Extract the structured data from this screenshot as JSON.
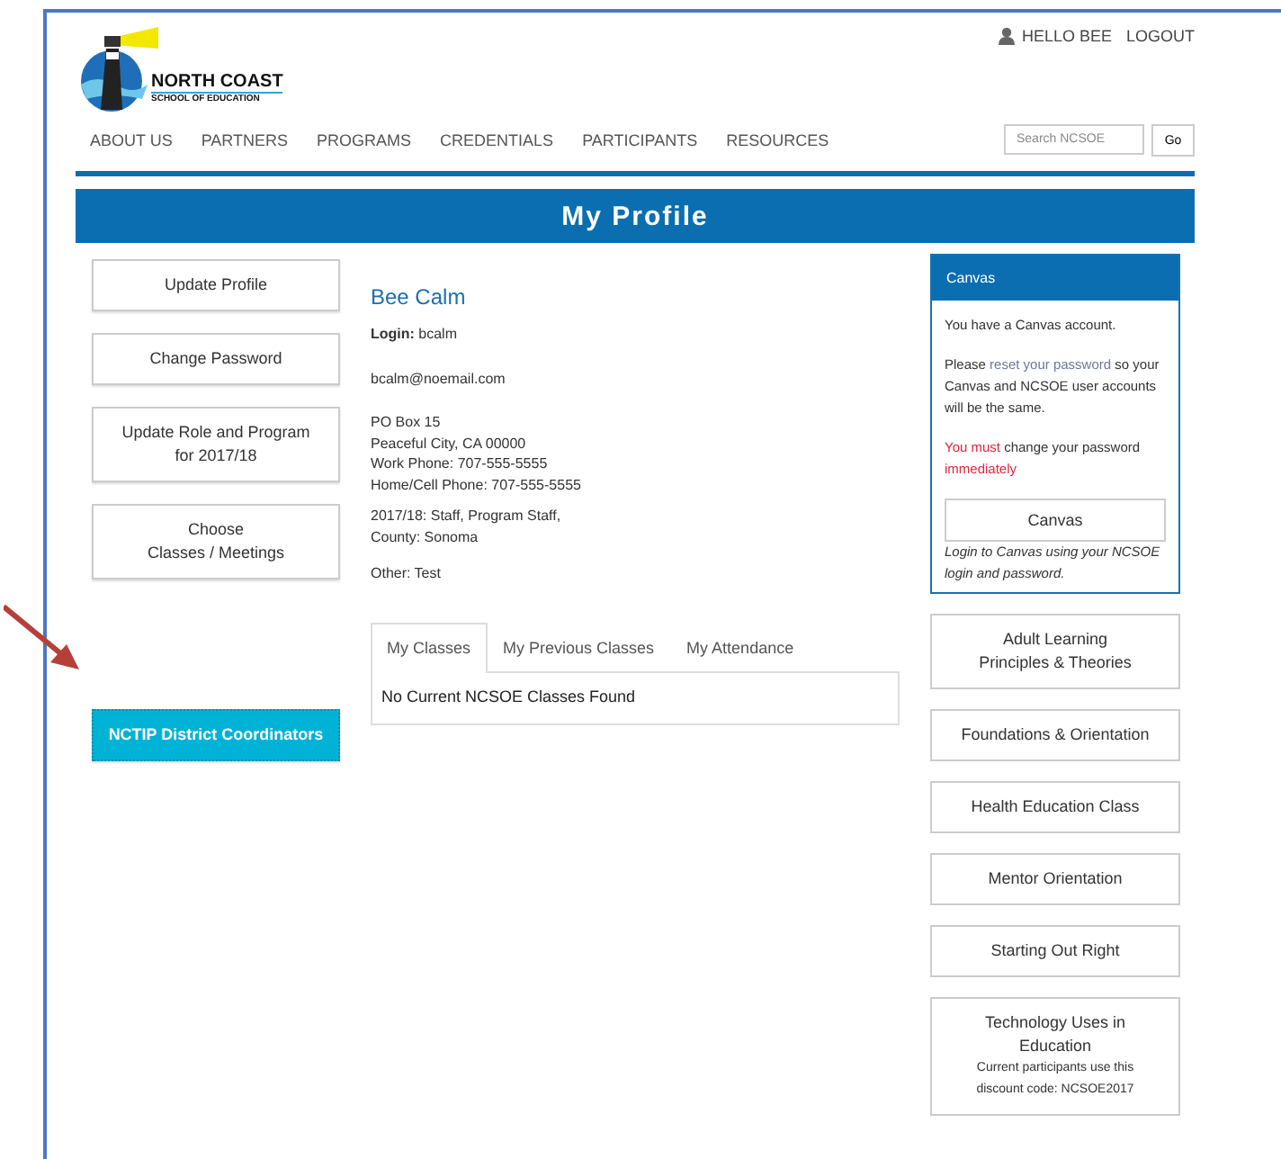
{
  "user_bar": {
    "greeting": "HELLO BEE",
    "logout": "LOGOUT"
  },
  "logo": {
    "name": "NORTH COAST",
    "subtitle": "SCHOOL OF EDUCATION"
  },
  "nav": [
    "ABOUT US",
    "PARTNERS",
    "PROGRAMS",
    "CREDENTIALS",
    "PARTICIPANTS",
    "RESOURCES"
  ],
  "search": {
    "placeholder": "Search NCSOE",
    "button": "Go"
  },
  "page_title": "My Profile",
  "left_buttons": [
    {
      "label": "Update Profile",
      "kind": "plain"
    },
    {
      "label": "Change Password",
      "kind": "plain"
    },
    {
      "label": "Update Role and Program\nfor 2017/18",
      "kind": "plain"
    },
    {
      "label": "Choose\nClasses / Meetings",
      "kind": "plain"
    },
    {
      "label": "NCTIP District Coordinators",
      "kind": "primary"
    }
  ],
  "profile": {
    "name": "Bee Calm",
    "login_label": "Login:",
    "login": "bcalm",
    "email": "bcalm@noemail.com",
    "address": [
      "PO Box 15",
      "Peaceful City, CA 00000",
      "Work Phone: 707-555-5555",
      "Home/Cell Phone: 707-555-5555"
    ],
    "role": [
      "2017/18: Staff, Program Staff,",
      "County: Sonoma"
    ],
    "other": "Other: Test"
  },
  "tabs": [
    {
      "label": "My Classes",
      "selected": true
    },
    {
      "label": "My Previous Classes",
      "selected": false
    },
    {
      "label": "My Attendance",
      "selected": false
    }
  ],
  "tab_content": "No Current NCSOE Classes Found",
  "canvas_panel": {
    "title": "Canvas",
    "account": "You have a Canvas account.",
    "reset": [
      {
        "kind": "text",
        "text": "Please "
      },
      {
        "kind": "link",
        "text": "reset your password"
      },
      {
        "kind": "text",
        "text": " so your Canvas and NCSOE user accounts will be the same."
      }
    ],
    "warning": [
      {
        "kind": "alert",
        "text": "You must"
      },
      {
        "kind": "text",
        "text": " change your password "
      },
      {
        "kind": "alert",
        "text": "immediately"
      }
    ],
    "button": "Canvas",
    "note": "Login to Canvas using your NCSOE login and password."
  },
  "class_buttons": [
    {
      "label": "Adult Learning\nPrinciples & Theories"
    },
    {
      "label": "Foundations & Orientation"
    },
    {
      "label": "Health Education Class"
    },
    {
      "label": "Mentor Orientation"
    },
    {
      "label": "Starting Out Right"
    },
    {
      "label": "Technology Uses in\nEducation",
      "note": "Current participants use this\ndiscount code: NCSOE2017"
    }
  ]
}
